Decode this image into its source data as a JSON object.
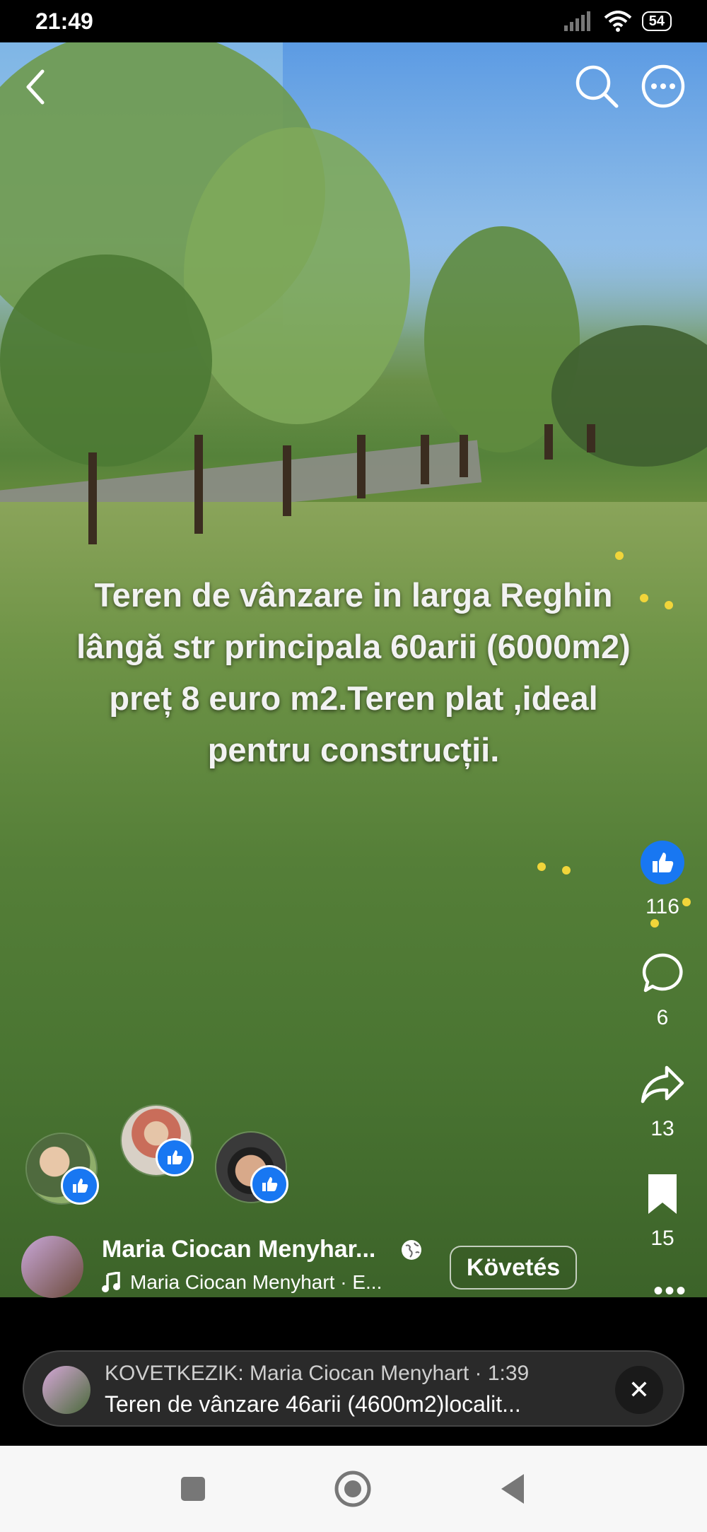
{
  "status_bar": {
    "time": "21:49",
    "battery": "54"
  },
  "overlay_text": [
    "Teren de vânzare in larga Reghin",
    "lângă str principala 60arii (6000m2)",
    "preț 8 euro m2.Teren plat ,ideal",
    "pentru construcții."
  ],
  "actions": {
    "likes": "116",
    "comments": "6",
    "shares": "13",
    "saves": "15"
  },
  "author": {
    "name": "Maria Ciocan Menyhar...",
    "music": "Maria Ciocan Menyhart · E..."
  },
  "follow_label": "Követés",
  "next_up": {
    "label": "KOVETKEZIK: Maria Ciocan Menyhart · 1:39",
    "title": "Teren de vânzare 46arii (4600m2)localit..."
  },
  "colors": {
    "like_blue": "#1877f2",
    "nav_bg": "#f7f7f7"
  },
  "icons": [
    "back-icon",
    "search-icon",
    "more-icon",
    "like-icon",
    "comment-icon",
    "share-icon",
    "bookmark-icon",
    "globe-icon",
    "music-icon",
    "close-icon",
    "square-nav-icon",
    "home-nav-icon",
    "back-nav-icon"
  ]
}
